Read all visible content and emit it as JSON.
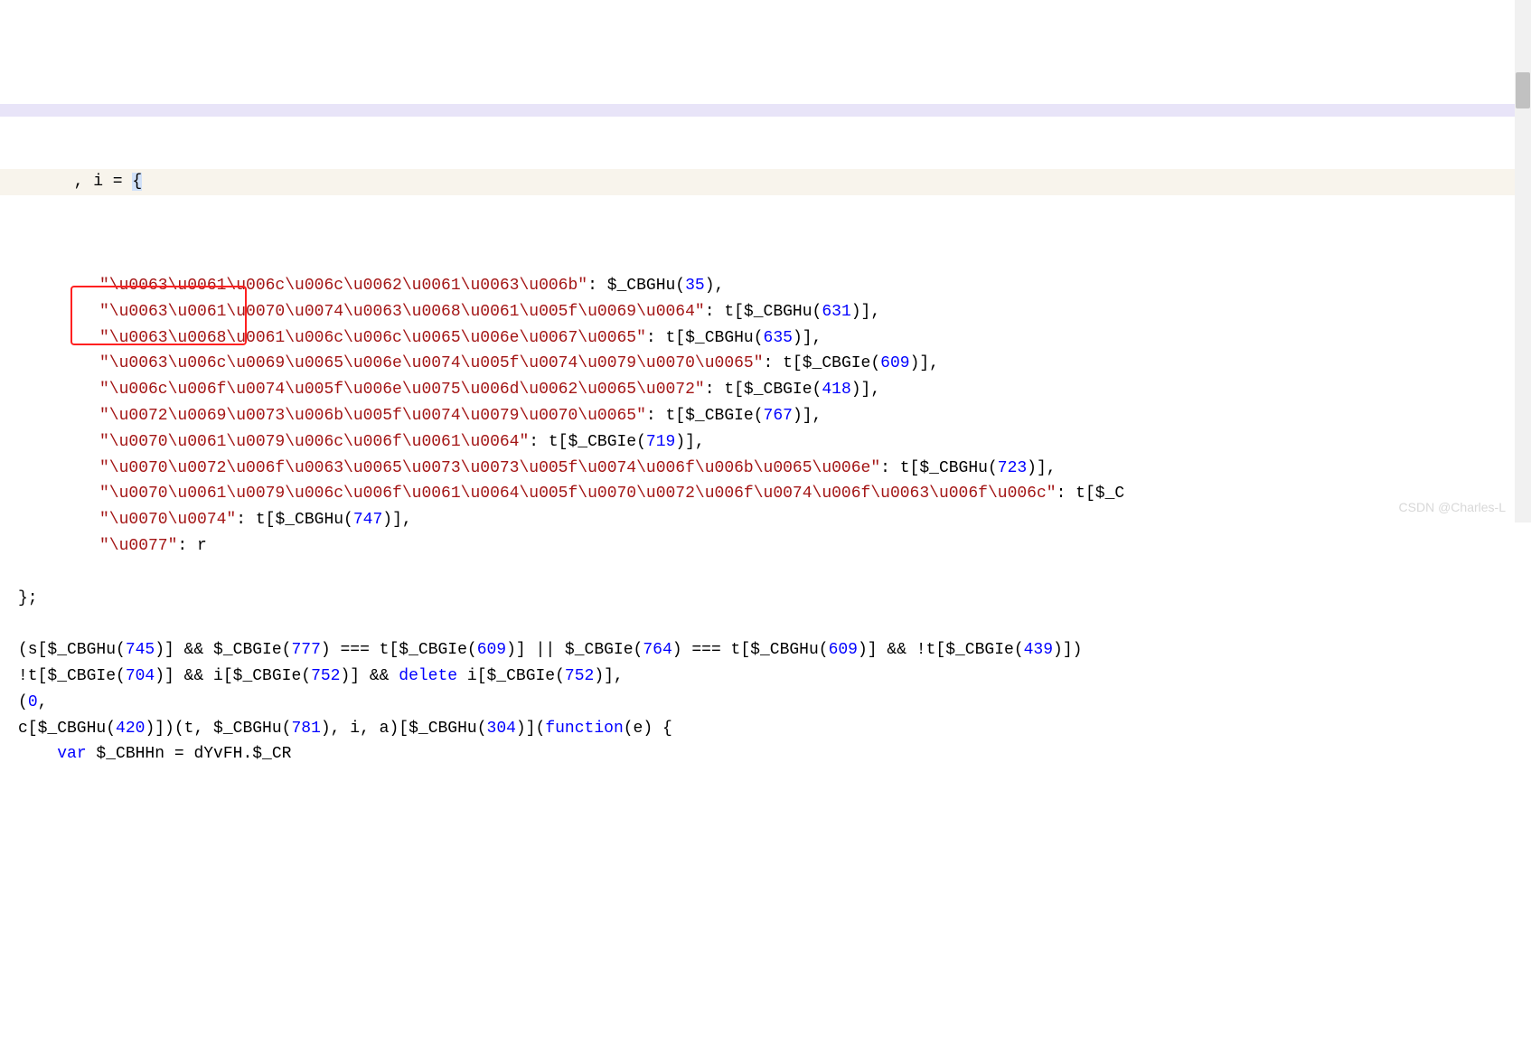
{
  "top_partial": "",
  "line_header": "  , i = ",
  "brace_open": "{",
  "object_entries": [
    {
      "key": "\"\\u0063\\u0061\\u006c\\u006c\\u0062\\u0061\\u0063\\u006b\"",
      "value_prefix": ": $_CBGHu(",
      "value_num": "35",
      "value_suffix": "),"
    },
    {
      "key": "\"\\u0063\\u0061\\u0070\\u0074\\u0063\\u0068\\u0061\\u005f\\u0069\\u0064\"",
      "value_prefix": ": t[$_CBGHu(",
      "value_num": "631",
      "value_suffix": ")],"
    },
    {
      "key": "\"\\u0063\\u0068\\u0061\\u006c\\u006c\\u0065\\u006e\\u0067\\u0065\"",
      "value_prefix": ": t[$_CBGHu(",
      "value_num": "635",
      "value_suffix": ")],"
    },
    {
      "key": "\"\\u0063\\u006c\\u0069\\u0065\\u006e\\u0074\\u005f\\u0074\\u0079\\u0070\\u0065\"",
      "value_prefix": ": t[$_CBGIe(",
      "value_num": "609",
      "value_suffix": ")],"
    },
    {
      "key": "\"\\u006c\\u006f\\u0074\\u005f\\u006e\\u0075\\u006d\\u0062\\u0065\\u0072\"",
      "value_prefix": ": t[$_CBGIe(",
      "value_num": "418",
      "value_suffix": ")],"
    },
    {
      "key": "\"\\u0072\\u0069\\u0073\\u006b\\u005f\\u0074\\u0079\\u0070\\u0065\"",
      "value_prefix": ": t[$_CBGIe(",
      "value_num": "767",
      "value_suffix": ")],"
    },
    {
      "key": "\"\\u0070\\u0061\\u0079\\u006c\\u006f\\u0061\\u0064\"",
      "value_prefix": ": t[$_CBGIe(",
      "value_num": "719",
      "value_suffix": ")],"
    },
    {
      "key": "\"\\u0070\\u0072\\u006f\\u0063\\u0065\\u0073\\u0073\\u005f\\u0074\\u006f\\u006b\\u0065\\u006e\"",
      "value_prefix": ": t[$_CBGHu(",
      "value_num": "723",
      "value_suffix": ")],"
    },
    {
      "key": "\"\\u0070\\u0061\\u0079\\u006c\\u006f\\u0061\\u0064\\u005f\\u0070\\u0072\\u006f\\u0074\\u006f\\u0063\\u006f\\u006c\"",
      "value_prefix": ": t[$_C",
      "value_num": "",
      "value_suffix": ""
    },
    {
      "key": "\"\\u0070\\u0074\"",
      "value_prefix": ": t[$_CBGHu(",
      "value_num": "747",
      "value_suffix": ")],"
    },
    {
      "key": "\"\\u0077\"",
      "value_prefix": ": r",
      "value_num": "",
      "value_suffix": ""
    }
  ],
  "close": "};",
  "tail_lines": [
    {
      "segments": [
        {
          "t": "(s[$_CBGHu("
        },
        {
          "n": "745"
        },
        {
          "t": ")] && $_CBGIe("
        },
        {
          "n": "777"
        },
        {
          "t": ") === t[$_CBGIe("
        },
        {
          "n": "609"
        },
        {
          "t": ")] || $_CBGIe("
        },
        {
          "n": "764"
        },
        {
          "t": ") === t[$_CBGHu("
        },
        {
          "n": "609"
        },
        {
          "t": ")] && !t[$_CBGIe("
        },
        {
          "n": "439"
        },
        {
          "t": ")])"
        }
      ]
    },
    {
      "segments": [
        {
          "t": "!t[$_CBGIe("
        },
        {
          "n": "704"
        },
        {
          "t": ")] && i[$_CBGIe("
        },
        {
          "n": "752"
        },
        {
          "t": ")] && "
        },
        {
          "k": "delete"
        },
        {
          "t": " i[$_CBGIe("
        },
        {
          "n": "752"
        },
        {
          "t": ")],"
        }
      ]
    },
    {
      "segments": [
        {
          "t": "("
        },
        {
          "n": "0"
        },
        {
          "t": ","
        }
      ]
    },
    {
      "segments": [
        {
          "t": "c[$_CBGHu("
        },
        {
          "n": "420"
        },
        {
          "t": ")])(t, $_CBGHu("
        },
        {
          "n": "781"
        },
        {
          "t": "), i, a)[$_CBGHu("
        },
        {
          "n": "304"
        },
        {
          "t": ")]("
        },
        {
          "k": "function"
        },
        {
          "t": "(e) {"
        }
      ]
    },
    {
      "segments": [
        {
          "t": "    "
        },
        {
          "k": "var"
        },
        {
          "t": " $_CBHHn = dYvFH.$_CR"
        }
      ]
    }
  ],
  "watermark": "CSDN @Charles-L"
}
